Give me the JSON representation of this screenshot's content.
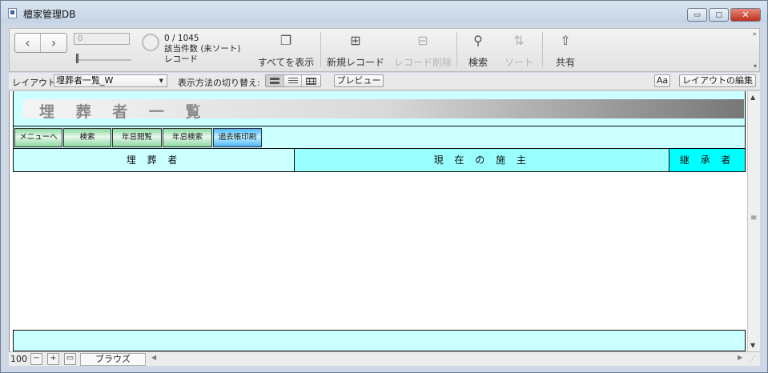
{
  "window": {
    "title": "檀家管理DB",
    "minimize": "▭",
    "maximize": "□",
    "close": "✕"
  },
  "toolbar": {
    "nav_prev": "‹",
    "nav_next": "›",
    "record_current": "0",
    "found": "0 / 1045",
    "found_detail": "該当件数 (未ソート)",
    "record_label": "レコード",
    "items": [
      {
        "label": "すべてを表示",
        "icon": "show-all-icon",
        "glyph": "❐",
        "enabled": true
      },
      {
        "label": "新規レコード",
        "icon": "add-record-icon",
        "glyph": "⊞",
        "enabled": true
      },
      {
        "label": "レコード削除",
        "icon": "delete-record-icon",
        "glyph": "⊟",
        "enabled": false
      },
      {
        "label": "検索",
        "icon": "search-icon",
        "glyph": "⚲",
        "enabled": true
      },
      {
        "label": "ソート",
        "icon": "sort-icon",
        "glyph": "⇅",
        "enabled": false
      },
      {
        "label": "共有",
        "icon": "share-icon",
        "glyph": "⇧",
        "enabled": true
      }
    ],
    "more": "»"
  },
  "layoutbar": {
    "layout_label": "レイアウト:",
    "layout_value": "埋葬者一覧_W",
    "view_label": "表示方法の切り替え:",
    "preview_label": "プレビュー",
    "text_format_label": "Aa",
    "edit_layout_label": "レイアウトの編集"
  },
  "content": {
    "header_title": "埋 葬 者 一 覧",
    "buttons": [
      {
        "label": "メニューへ",
        "color": "green"
      },
      {
        "label": "検索",
        "color": "green"
      },
      {
        "label": "年忌閲覧",
        "color": "green"
      },
      {
        "label": "年忌検索",
        "color": "green"
      },
      {
        "label": "過去帳印刷",
        "color": "blue"
      }
    ],
    "columns": [
      "埋 葬 者",
      "現 在 の 施 主",
      "継 承 者"
    ]
  },
  "statusbar": {
    "zoom": "100",
    "zoom_out": "−",
    "zoom_in": "+",
    "toggle": "▭",
    "mode": "ブラウズ"
  },
  "colors": {
    "header_bg": "#ccffff",
    "col_burial_bg": "#ccffff",
    "col_owner_bg": "#99ffff",
    "col_successor_bg": "#00ffff",
    "button_green": "#8ad89f",
    "button_blue": "#4fb4ff"
  }
}
